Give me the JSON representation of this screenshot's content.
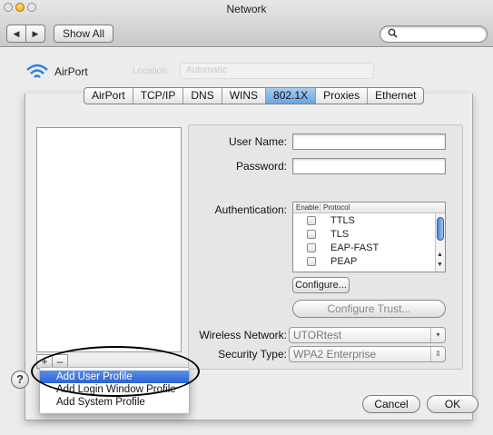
{
  "window": {
    "title": "Network"
  },
  "toolbar": {
    "back_label": "◀",
    "forward_label": "▶",
    "show_all_label": "Show All",
    "search_placeholder": ""
  },
  "location_bar": {
    "service_label": "AirPort",
    "location_label": "Location:",
    "location_value": "Automatic"
  },
  "tabs": [
    "AirPort",
    "TCP/IP",
    "DNS",
    "WINS",
    "802.1X",
    "Proxies",
    "Ethernet"
  ],
  "active_tab": "802.1X",
  "form": {
    "user_name_label": "User Name:",
    "user_name_value": "",
    "password_label": "Password:",
    "password_value": "",
    "authentication_label": "Authentication:",
    "protocol_table": {
      "headers": [
        "Enable",
        "Protocol"
      ],
      "rows": [
        {
          "enabled": false,
          "protocol": "TTLS"
        },
        {
          "enabled": false,
          "protocol": "TLS"
        },
        {
          "enabled": false,
          "protocol": "EAP-FAST"
        },
        {
          "enabled": false,
          "protocol": "PEAP"
        }
      ]
    },
    "configure_label": "Configure...",
    "configure_trust_label": "Configure Trust...",
    "wireless_network_label": "Wireless Network:",
    "wireless_network_value": "UTORtest",
    "security_type_label": "Security Type:",
    "security_type_value": "WPA2 Enterprise"
  },
  "profile_list": {
    "add_label": "+",
    "remove_label": "–"
  },
  "add_menu": {
    "items": [
      "Add User Profile",
      "Add Login Window Profile",
      "Add System Profile"
    ],
    "highlighted_index": 0
  },
  "footer": {
    "help_label": "?",
    "cancel_label": "Cancel",
    "ok_label": "OK"
  },
  "colors": {
    "active_tab": "#6aa3e3",
    "menu_highlight": "#2a63d3",
    "scroll_thumb": "#4b86d6"
  }
}
